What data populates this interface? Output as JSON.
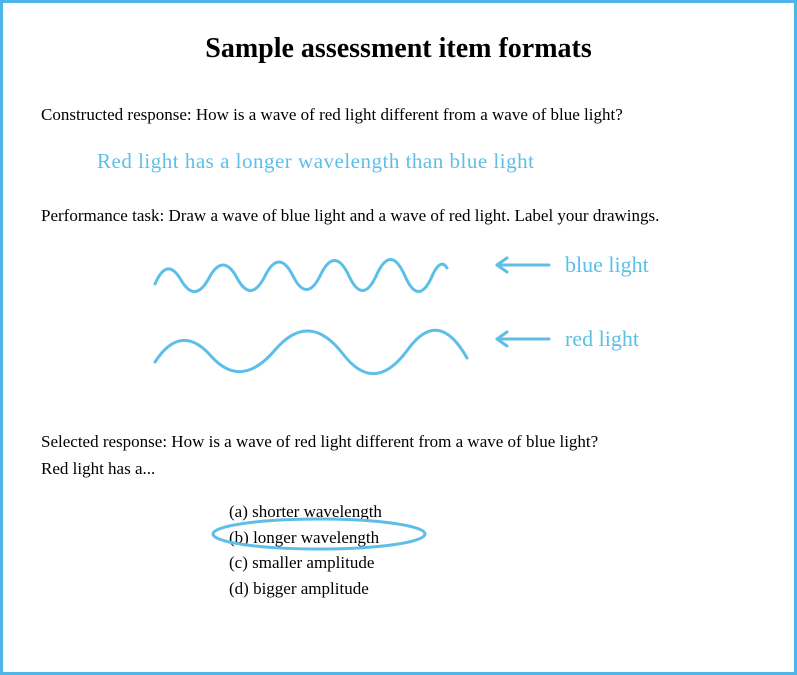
{
  "title": "Sample assessment item formats",
  "constructed": {
    "prompt": "Constructed response: How is a wave of red light different from a wave of blue light?",
    "answer": "Red light has a longer wavelength than blue light"
  },
  "performance": {
    "prompt": "Performance task: Draw a wave of blue light and a wave of red light. Label your drawings.",
    "label_blue": "blue light",
    "label_red": "red light"
  },
  "selected": {
    "prompt_line1": "Selected response: How is a wave of red light different from a wave of blue light?",
    "prompt_line2": "Red light has a...",
    "options": {
      "a": "(a) shorter wavelength",
      "b": "(b) longer wavelength",
      "c": "(c) smaller amplitude",
      "d": "(d) bigger amplitude"
    }
  },
  "colors": {
    "accent": "#5DBFE8",
    "border": "#4DB5E8"
  }
}
